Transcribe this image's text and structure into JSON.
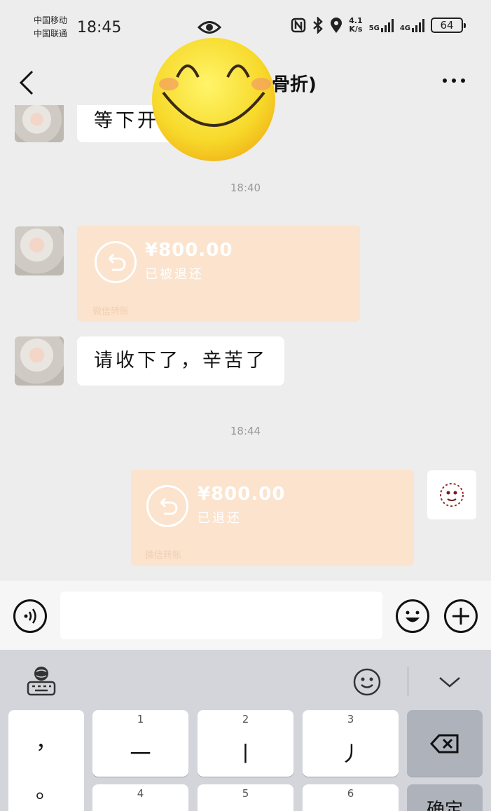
{
  "status_bar": {
    "carrier_1": "中国移动",
    "carrier_2": "中国联通",
    "time": "18:45",
    "speed_value": "4.1",
    "speed_unit": "K/s",
    "net_1": "5G",
    "net_2": "4G",
    "battery": "64",
    "icons": [
      "eye-icon",
      "nfc-icon",
      "bluetooth-icon",
      "location-icon",
      "signal-icon",
      "battery-icon"
    ]
  },
  "nav": {
    "title": "骨折)",
    "icons": [
      "back-chevron-icon",
      "more-dots-icon"
    ]
  },
  "messages": {
    "partial_text": "等下开",
    "time_1": "18:40",
    "transfer_1": {
      "amount": "¥800.00",
      "state": "已被退还",
      "foot": "微信转账"
    },
    "text_1": "请收下了，辛苦了",
    "time_2": "18:44",
    "transfer_2": {
      "amount": "¥800.00",
      "state": "已退还",
      "foot": "微信转账"
    }
  },
  "sticker": {
    "name": "smiley-face-icon"
  },
  "input_bar": {
    "icons": [
      "voice-icon",
      "emoji-icon",
      "plus-icon"
    ],
    "text": ""
  },
  "keyboard": {
    "toolbar_icons": [
      "keyboard-globe-icon",
      "emoji-icon",
      "collapse-chevron-icon"
    ],
    "punct_1": "，",
    "punct_2": "。",
    "keys": [
      {
        "num": "1",
        "glyph": "一"
      },
      {
        "num": "2",
        "glyph": "丨"
      },
      {
        "num": "3",
        "glyph": "丿"
      },
      {
        "num": "4",
        "glyph": ""
      },
      {
        "num": "5",
        "glyph": ""
      },
      {
        "num": "6",
        "glyph": ""
      }
    ],
    "confirm_label": "确定"
  },
  "colors": {
    "background": "#ededed",
    "transfer_returned": "#fbe3cd",
    "bubble": "#ffffff",
    "keyboard": "#d3d5db"
  }
}
